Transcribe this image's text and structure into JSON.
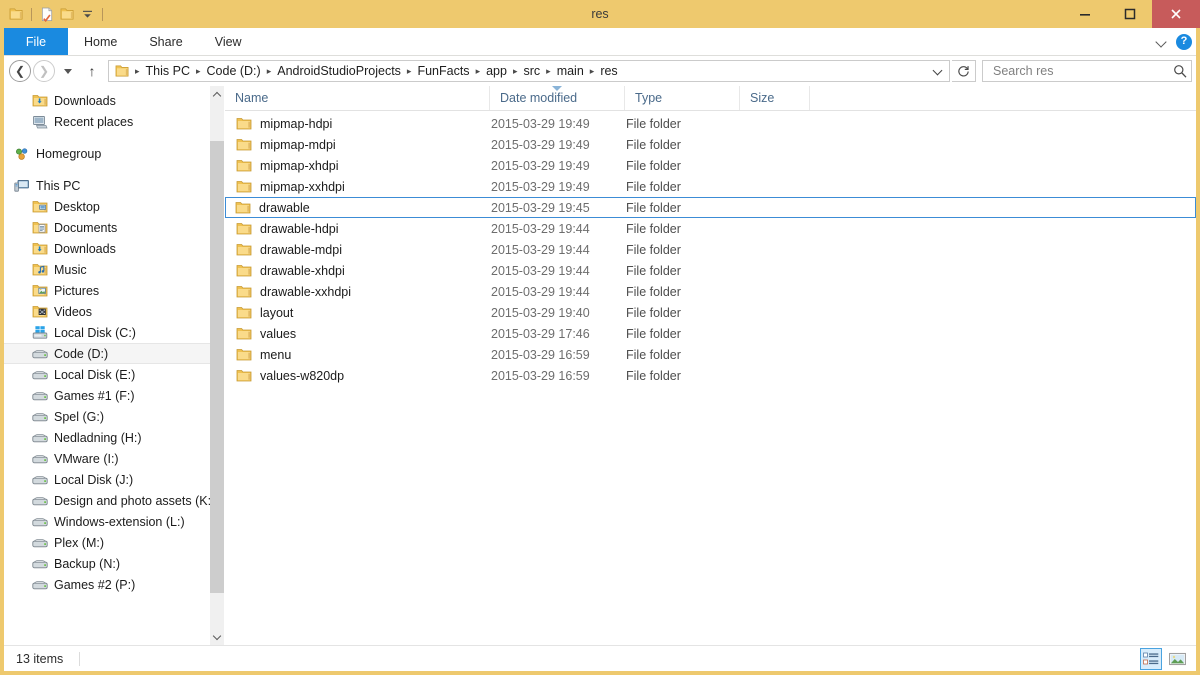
{
  "window": {
    "title": "res",
    "accent_titlebar": "#eec96e",
    "close_button_color": "#c75b5b",
    "selection_border": "#3c8cd6",
    "file_tab_color": "#1a8ae0"
  },
  "quick_access": {
    "items": [
      {
        "name": "folder-icon",
        "label": "Properties"
      },
      {
        "name": "new-folder-icon",
        "label": "New folder"
      },
      {
        "name": "folder-icon",
        "label": "Folder"
      }
    ],
    "customize_label": "Customize Quick Access Toolbar"
  },
  "window_controls": {
    "minimize": "–",
    "maximize": "□",
    "close": "✕"
  },
  "ribbon": {
    "tabs": [
      {
        "id": "file",
        "label": "File",
        "active": true
      },
      {
        "id": "home",
        "label": "Home",
        "active": false
      },
      {
        "id": "share",
        "label": "Share",
        "active": false
      },
      {
        "id": "view",
        "label": "View",
        "active": false
      }
    ],
    "expand_label": "Expand the Ribbon",
    "help_label": "?"
  },
  "address_bar": {
    "back_label": "Back",
    "forward_label": "Forward",
    "recent_label": "Recent locations",
    "up_label": "Up one level",
    "refresh_label": "Refresh",
    "dropdown_label": "Previous locations",
    "crumb_separator": "▸",
    "crumbs": [
      "This PC",
      "Code (D:)",
      "AndroidStudioProjects",
      "FunFacts",
      "app",
      "src",
      "main",
      "res"
    ]
  },
  "search": {
    "placeholder": "Search res",
    "value": "",
    "icon": "search-icon"
  },
  "sidebar": {
    "groups": [
      {
        "id": "favorites-tail",
        "items": [
          {
            "label": "Downloads",
            "icon": "downloads-icon",
            "indent": 1,
            "selected": false
          },
          {
            "label": "Recent places",
            "icon": "recent-places-icon",
            "indent": 1,
            "selected": false
          }
        ]
      },
      {
        "id": "homegroup",
        "items": [
          {
            "label": "Homegroup",
            "icon": "homegroup-icon",
            "indent": 0,
            "selected": false
          }
        ]
      },
      {
        "id": "this-pc",
        "items": [
          {
            "label": "This PC",
            "icon": "this-pc-icon",
            "indent": 0,
            "selected": false
          },
          {
            "label": "Desktop",
            "icon": "desktop-icon",
            "indent": 1,
            "selected": false
          },
          {
            "label": "Documents",
            "icon": "documents-icon",
            "indent": 1,
            "selected": false
          },
          {
            "label": "Downloads",
            "icon": "downloads-icon",
            "indent": 1,
            "selected": false
          },
          {
            "label": "Music",
            "icon": "music-icon",
            "indent": 1,
            "selected": false
          },
          {
            "label": "Pictures",
            "icon": "pictures-icon",
            "indent": 1,
            "selected": false
          },
          {
            "label": "Videos",
            "icon": "videos-icon",
            "indent": 1,
            "selected": false
          },
          {
            "label": "Local Disk (C:)",
            "icon": "windows-drive-icon",
            "indent": 1,
            "selected": false
          },
          {
            "label": "Code (D:)",
            "icon": "drive-icon",
            "indent": 1,
            "selected": true
          },
          {
            "label": "Local Disk (E:)",
            "icon": "drive-icon",
            "indent": 1,
            "selected": false
          },
          {
            "label": "Games #1 (F:)",
            "icon": "drive-icon",
            "indent": 1,
            "selected": false
          },
          {
            "label": "Spel (G:)",
            "icon": "drive-icon",
            "indent": 1,
            "selected": false
          },
          {
            "label": "Nedladning (H:)",
            "icon": "drive-icon",
            "indent": 1,
            "selected": false
          },
          {
            "label": "VMware (I:)",
            "icon": "drive-icon",
            "indent": 1,
            "selected": false
          },
          {
            "label": "Local Disk (J:)",
            "icon": "drive-icon",
            "indent": 1,
            "selected": false
          },
          {
            "label": "Design and photo assets (K:)",
            "icon": "drive-icon",
            "indent": 1,
            "selected": false
          },
          {
            "label": "Windows-extension (L:)",
            "icon": "drive-icon",
            "indent": 1,
            "selected": false
          },
          {
            "label": "Plex (M:)",
            "icon": "drive-icon",
            "indent": 1,
            "selected": false
          },
          {
            "label": "Backup (N:)",
            "icon": "drive-icon",
            "indent": 1,
            "selected": false
          },
          {
            "label": "Games #2 (P:)",
            "icon": "drive-icon",
            "indent": 1,
            "selected": false
          }
        ]
      }
    ]
  },
  "file_list": {
    "columns": [
      {
        "id": "name",
        "label": "Name",
        "sorted": false
      },
      {
        "id": "date",
        "label": "Date modified",
        "sorted": true,
        "direction": "desc"
      },
      {
        "id": "type",
        "label": "Type",
        "sorted": false
      },
      {
        "id": "size",
        "label": "Size",
        "sorted": false
      }
    ],
    "rows": [
      {
        "name": "mipmap-hdpi",
        "date": "2015-03-29 19:49",
        "type": "File folder",
        "size": "",
        "icon": "folder-icon",
        "selected": false
      },
      {
        "name": "mipmap-mdpi",
        "date": "2015-03-29 19:49",
        "type": "File folder",
        "size": "",
        "icon": "folder-icon",
        "selected": false
      },
      {
        "name": "mipmap-xhdpi",
        "date": "2015-03-29 19:49",
        "type": "File folder",
        "size": "",
        "icon": "folder-icon",
        "selected": false
      },
      {
        "name": "mipmap-xxhdpi",
        "date": "2015-03-29 19:49",
        "type": "File folder",
        "size": "",
        "icon": "folder-icon",
        "selected": false
      },
      {
        "name": "drawable",
        "date": "2015-03-29 19:45",
        "type": "File folder",
        "size": "",
        "icon": "folder-icon",
        "selected": true
      },
      {
        "name": "drawable-hdpi",
        "date": "2015-03-29 19:44",
        "type": "File folder",
        "size": "",
        "icon": "folder-icon",
        "selected": false
      },
      {
        "name": "drawable-mdpi",
        "date": "2015-03-29 19:44",
        "type": "File folder",
        "size": "",
        "icon": "folder-icon",
        "selected": false
      },
      {
        "name": "drawable-xhdpi",
        "date": "2015-03-29 19:44",
        "type": "File folder",
        "size": "",
        "icon": "folder-icon",
        "selected": false
      },
      {
        "name": "drawable-xxhdpi",
        "date": "2015-03-29 19:44",
        "type": "File folder",
        "size": "",
        "icon": "folder-icon",
        "selected": false
      },
      {
        "name": "layout",
        "date": "2015-03-29 19:40",
        "type": "File folder",
        "size": "",
        "icon": "folder-icon",
        "selected": false
      },
      {
        "name": "values",
        "date": "2015-03-29 17:46",
        "type": "File folder",
        "size": "",
        "icon": "folder-icon",
        "selected": false
      },
      {
        "name": "menu",
        "date": "2015-03-29 16:59",
        "type": "File folder",
        "size": "",
        "icon": "folder-icon",
        "selected": false
      },
      {
        "name": "values-w820dp",
        "date": "2015-03-29 16:59",
        "type": "File folder",
        "size": "",
        "icon": "folder-icon",
        "selected": false
      }
    ]
  },
  "status_bar": {
    "item_count": "13 items",
    "views": [
      {
        "id": "details",
        "label": "Details view",
        "icon": "details-view-icon",
        "active": true
      },
      {
        "id": "large-icons",
        "label": "Large icons view",
        "icon": "large-icons-view-icon",
        "active": false
      }
    ]
  }
}
